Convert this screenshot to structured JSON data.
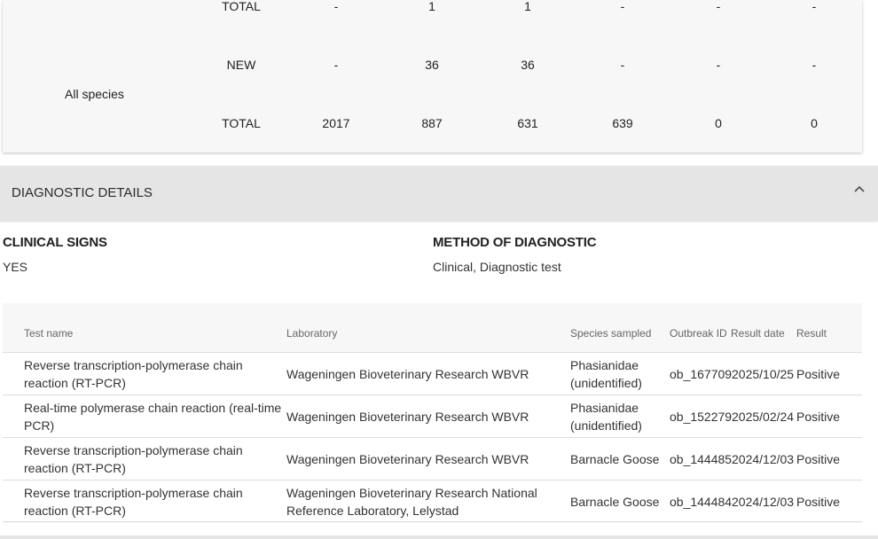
{
  "summary": {
    "row_total_top": {
      "label": "TOTAL",
      "values": [
        "-",
        "1",
        "1",
        "-",
        "-",
        "-"
      ]
    },
    "group_label": "All species",
    "row_new": {
      "label": "NEW",
      "values": [
        "-",
        "36",
        "36",
        "-",
        "-",
        "-"
      ]
    },
    "row_total": {
      "label": "TOTAL",
      "values": [
        "2017",
        "887",
        "631",
        "639",
        "0",
        "0"
      ]
    }
  },
  "diagnostic": {
    "title": "DIAGNOSTIC DETAILS",
    "clinical_signs_label": "CLINICAL SIGNS",
    "clinical_signs_value": "YES",
    "method_label": "METHOD OF DIAGNOSTIC",
    "method_value": "Clinical, Diagnostic test"
  },
  "tests": {
    "headers": [
      "Test name",
      "Laboratory",
      "Species sampled",
      "Outbreak ID",
      "Result date",
      "Result"
    ],
    "rows": [
      {
        "test": "Reverse transcription-polymerase chain reaction (RT-PCR)",
        "lab": "Wageningen Bioveterinary Research WBVR",
        "species": "Phasianidae (unidentified)",
        "outbreak": "ob_167709",
        "date": "2025/10/25",
        "result": "Positive"
      },
      {
        "test": "Real-time polymerase chain reaction (real-time PCR)",
        "lab": "Wageningen Bioveterinary Research WBVR",
        "species": "Phasianidae (unidentified)",
        "outbreak": "ob_152279",
        "date": "2025/02/24",
        "result": "Positive"
      },
      {
        "test": "Reverse transcription-polymerase chain reaction (RT-PCR)",
        "lab": "Wageningen Bioveterinary Research WBVR",
        "species": "Barnacle Goose",
        "outbreak": "ob_144485",
        "date": "2024/12/03",
        "result": "Positive"
      },
      {
        "test": "Reverse transcription-polymerase chain reaction (RT-PCR)",
        "lab": "Wageningen Bioveterinary Research National Reference Laboratory, Lelystad",
        "species": "Barnacle Goose",
        "outbreak": "ob_144484",
        "date": "2024/12/03",
        "result": "Positive"
      }
    ]
  },
  "icons": {
    "collapse": "chevron-up-icon"
  }
}
